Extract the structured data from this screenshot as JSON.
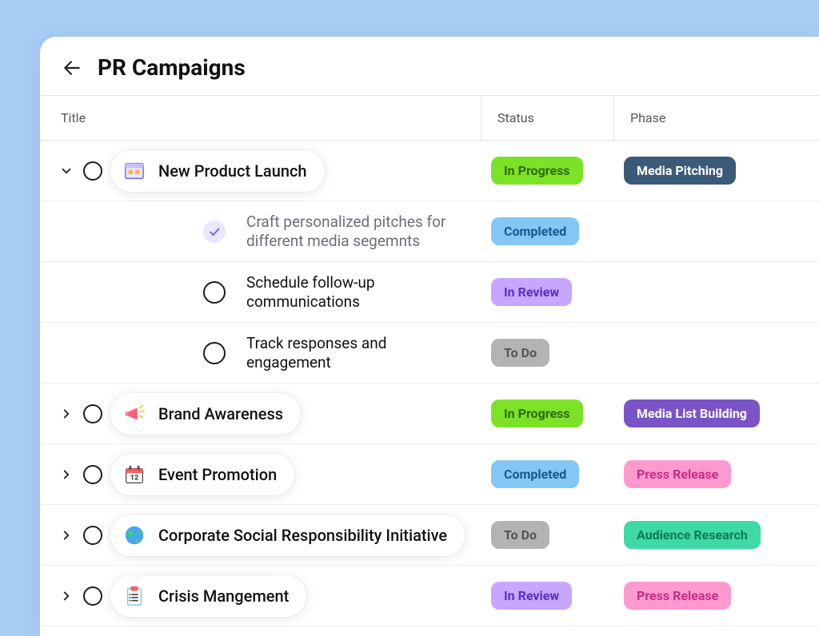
{
  "header": {
    "title": "PR Campaigns"
  },
  "columns": {
    "title": "Title",
    "status": "Status",
    "phase": "Phase"
  },
  "status_labels": {
    "inprogress": "In Progress",
    "completed": "Completed",
    "inreview": "In Review",
    "todo": "To Do"
  },
  "phase_labels": {
    "media_pitching": "Media Pitching",
    "media_list_building": "Media List Building",
    "press_release": "Press Release",
    "audience_research": "Audience Research"
  },
  "campaigns": [
    {
      "label": "New Product Launch",
      "icon": "browser-window-icon",
      "expanded": true,
      "status": "inprogress",
      "phase": "media_pitching",
      "subtasks": [
        {
          "label": "Craft personalized pitches for different media segemnts",
          "status": "completed",
          "checked": true
        },
        {
          "label": "Schedule follow-up communications",
          "status": "inreview",
          "checked": false
        },
        {
          "label": "Track responses and engagement",
          "status": "todo",
          "checked": false
        }
      ]
    },
    {
      "label": "Brand Awareness",
      "icon": "megaphone-icon",
      "expanded": false,
      "status": "inprogress",
      "phase": "media_list_building"
    },
    {
      "label": "Event Promotion",
      "icon": "calendar-icon",
      "expanded": false,
      "status": "completed",
      "phase": "press_release"
    },
    {
      "label": "Corporate Social Responsibility Initiative",
      "icon": "globe-icon",
      "expanded": false,
      "status": "todo",
      "phase": "audience_research"
    },
    {
      "label": "Crisis Mangement",
      "icon": "clipboard-icon",
      "expanded": false,
      "status": "inreview",
      "phase": "press_release"
    }
  ]
}
